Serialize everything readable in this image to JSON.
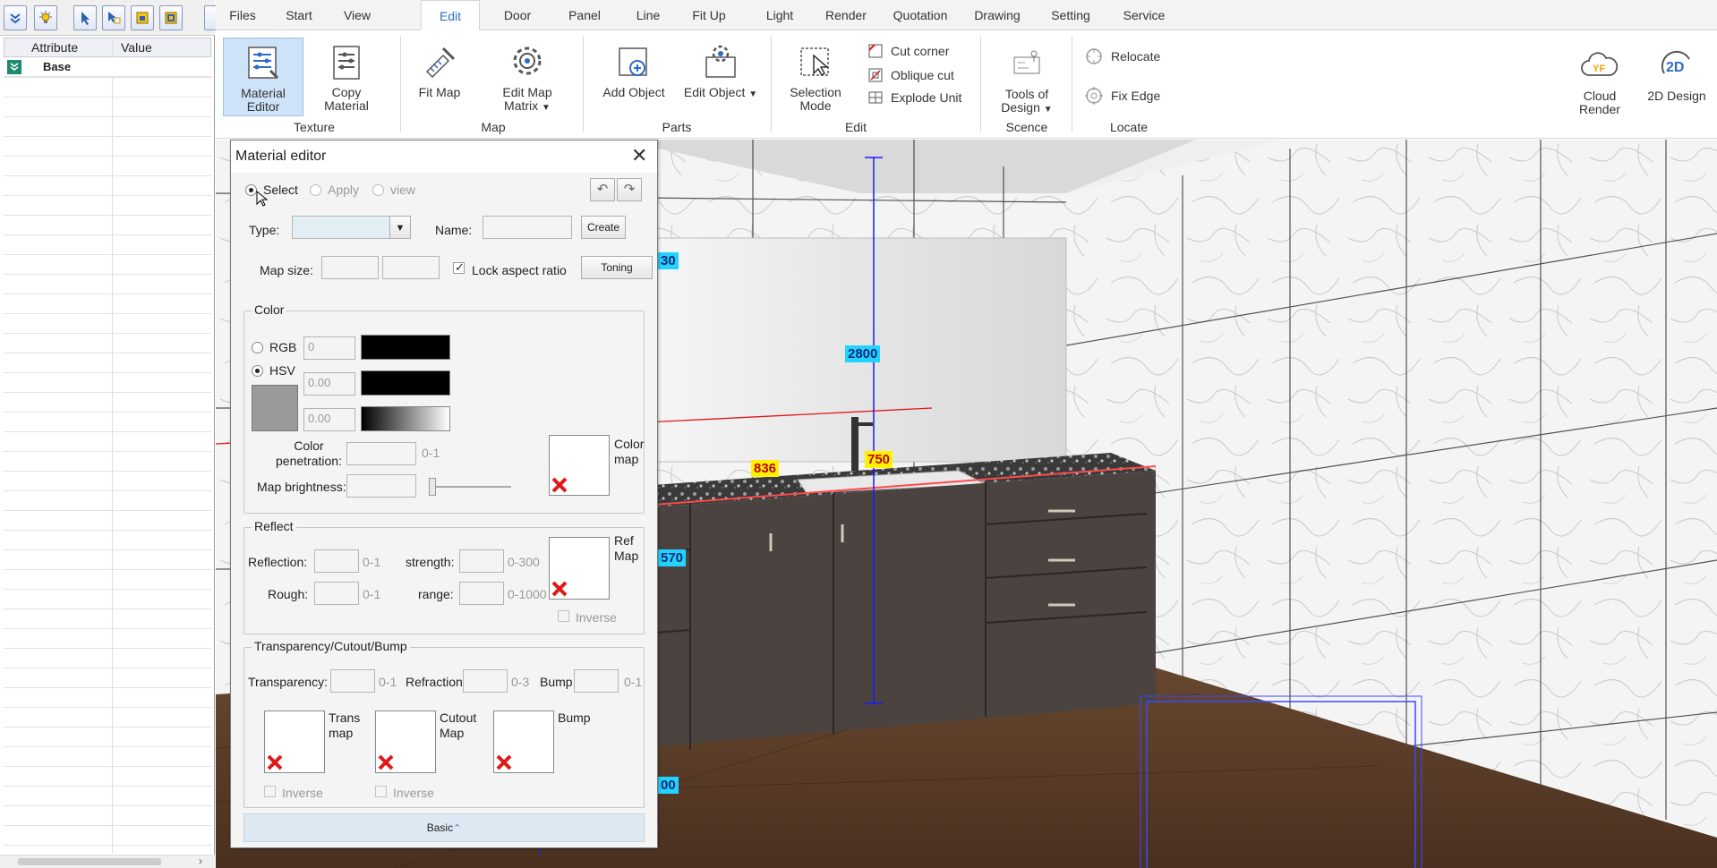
{
  "left_panel": {
    "headers": {
      "attribute": "Attribute",
      "value": "Value"
    },
    "rows": [
      {
        "label": "Base"
      }
    ]
  },
  "tabs": [
    "Files",
    "Start",
    "View",
    "Edit",
    "Door",
    "Panel",
    "Line",
    "Fit Up",
    "Light",
    "Render",
    "Quotation",
    "Drawing",
    "Setting",
    "Service"
  ],
  "active_tab": "Edit",
  "ribbon": {
    "material_editor": "Material Editor",
    "copy_material": "Copy Material",
    "fit_map": "Fit Map",
    "edit_map_matrix": "Edit Map Matrix",
    "add_object": "Add Object",
    "edit_object": "Edit Object",
    "selection_mode": "Selection Mode",
    "cut_corner": "Cut corner",
    "oblique_cut": "Oblique cut",
    "explode_unit": "Explode Unit",
    "tools_of_design": "Tools of Design",
    "relocate": "Relocate",
    "fix_edge": "Fix Edge",
    "cloud_render": "Cloud Render",
    "design_2d": "2D Design",
    "groups": {
      "texture": "Texture",
      "map": "Map",
      "parts": "Parts",
      "edit": "Edit",
      "scence": "Scence",
      "locate": "Locate"
    }
  },
  "dialog": {
    "title": "Material editor",
    "mode_select": "Select",
    "mode_apply": "Apply",
    "mode_view": "view",
    "type_label": "Type:",
    "name_label": "Name:",
    "create_btn": "Create",
    "map_size_label": "Map size:",
    "lock_aspect": "Lock aspect ratio",
    "toning_btn": "Toning",
    "color": {
      "legend": "Color",
      "rgb": "RGB",
      "hsv": "HSV",
      "v1": "0",
      "v2": "0.00",
      "v3": "0.00",
      "penetration": "Color penetration:",
      "penetration_range": "0-1",
      "color_map": "Color map",
      "map_brightness": "Map brightness:"
    },
    "reflect": {
      "legend": "Reflect",
      "reflection": "Reflection:",
      "reflection_range": "0-1",
      "strength": "strength:",
      "strength_range": "0-300",
      "rough": "Rough:",
      "rough_range": "0-1",
      "range": "range:",
      "range_range": "0-1000",
      "ref_map": "Ref Map",
      "inverse": "Inverse"
    },
    "tcb": {
      "legend": "Transparency/Cutout/Bump",
      "transparency": "Transparency:",
      "transparency_range": "0-1",
      "refraction": "Refraction",
      "refraction_range": "0-3",
      "bump": "Bump",
      "bump_range": "0-1",
      "trans_map": "Trans map",
      "cutout_map": "Cutout Map",
      "bump_map": "Bump",
      "inverse": "Inverse"
    },
    "basic_btn": "Basic"
  },
  "dims": {
    "d750a": "750",
    "d836": "836",
    "d750b": "750",
    "d2800": "2800",
    "d30": "30",
    "d570": "570",
    "d00": "00"
  },
  "colors": {
    "accent": "#2b6cc7",
    "tile": "#f3f3f3",
    "cabinet": "#4a4340",
    "floor": "#5a3c24",
    "dim_line": "#1a1aff",
    "red_line": "#e01818"
  }
}
